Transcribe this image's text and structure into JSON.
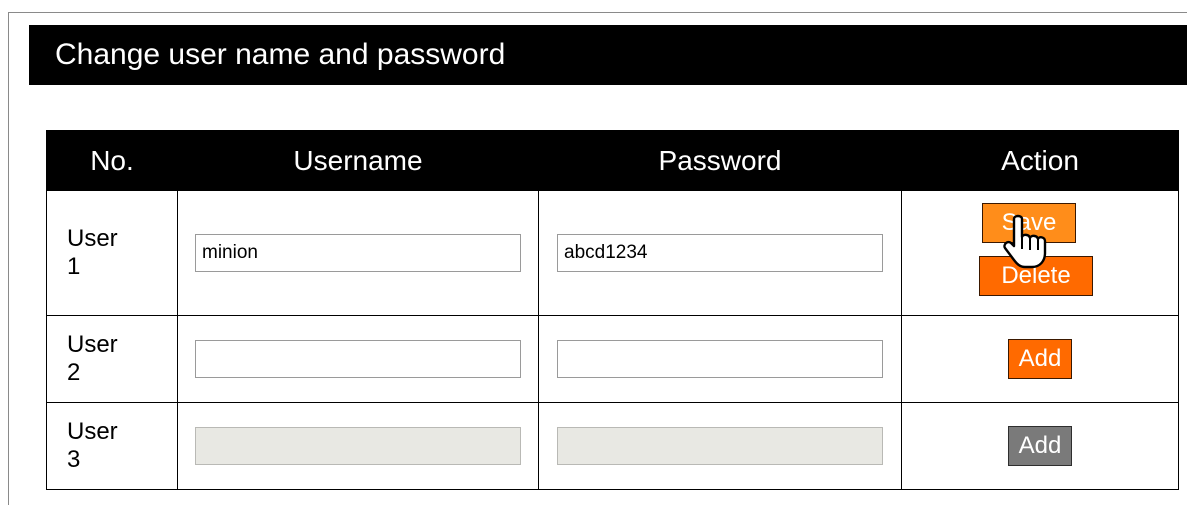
{
  "page": {
    "title": "Change user name and password"
  },
  "table": {
    "headers": {
      "no": "No.",
      "username": "Username",
      "password": "Password",
      "action": "Action"
    },
    "rows": [
      {
        "no_word": "User",
        "no_number": "1",
        "username": "minion",
        "password": "abcd1234",
        "editable": true,
        "primary_action": "Save",
        "secondary_action": "Delete"
      },
      {
        "no_word": "User",
        "no_number": "2",
        "username": "",
        "password": "",
        "editable": true,
        "primary_action": "Add"
      },
      {
        "no_word": "User",
        "no_number": "3",
        "username": "",
        "password": "",
        "editable": false,
        "primary_action": "Add"
      }
    ]
  },
  "colors": {
    "header_bg": "#000000",
    "button_orange": "#ff6a00",
    "button_orange_hover": "#ff8d1a",
    "button_disabled": "#7a7a7a",
    "disabled_field_bg": "#e8e8e3"
  },
  "icons": {
    "cursor": "hand-pointer-icon"
  }
}
